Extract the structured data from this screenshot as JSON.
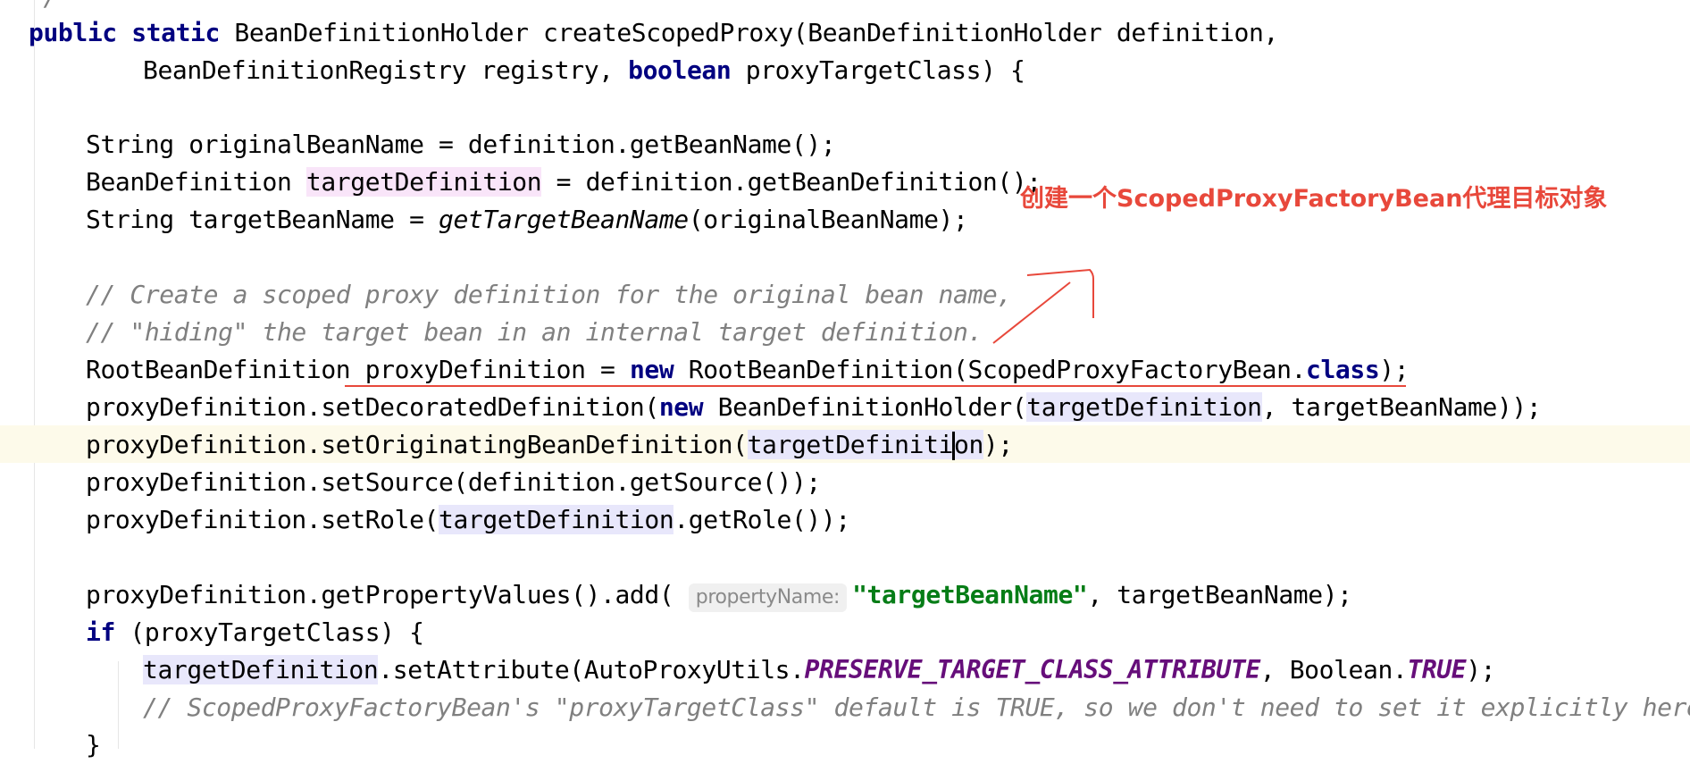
{
  "annotation_text": "创建一个ScopedProxyFactoryBean代理目标对象",
  "annotation_color": "#e8483b",
  "colors": {
    "keyword": "#000080",
    "comment": "#808080",
    "constant": "#660e7a",
    "string": "#067d17",
    "caret_line": "#fdfaea",
    "highlight_write": "#f9e5f9",
    "highlight_read": "#e8e7fb"
  },
  "code": {
    "line0": "*/",
    "line1": {
      "kw1": "public",
      "kw2": "static",
      "rest": " BeanDefinitionHolder createScopedProxy(BeanDefinitionHolder definition,"
    },
    "line2": {
      "pre": "BeanDefinitionRegistry registry, ",
      "kw": "boolean",
      "post": " proxyTargetClass) {"
    },
    "line3": "String originalBeanName = definition.getBeanName();",
    "line4": {
      "pre": "BeanDefinition ",
      "var": "targetDefinition",
      "post": " = definition.getBeanDefinition();"
    },
    "line5": {
      "pre": "String targetBeanName = ",
      "method": "getTargetBeanName",
      "post": "(originalBeanName);"
    },
    "line6": "// Create a scoped proxy definition for the original bean name,",
    "line7": "// \"hiding\" the target bean in an internal target definition.",
    "line8": {
      "pre": "RootBeanDefinition proxyDefinition = ",
      "kw": "new",
      "mid": " RootBeanDefinition(ScopedProxyFactoryBean.",
      "kw2": "class",
      "post": ");"
    },
    "line9": {
      "pre": "proxyDefinition.setDecoratedDefinition(",
      "kw": "new",
      "mid": " BeanDefinitionHolder(",
      "var": "targetDefinition",
      "post": ", targetBeanName));"
    },
    "line10": {
      "pre": "proxyDefinition.setOriginatingBeanDefinition(",
      "var_a": "targetDefiniti",
      "var_b": "on",
      "post": ");"
    },
    "line11": "proxyDefinition.setSource(definition.getSource());",
    "line12": {
      "pre": "proxyDefinition.setRole(",
      "var": "targetDefinition",
      "post": ".getRole());"
    },
    "line13": {
      "pre": "proxyDefinition.getPropertyValues().add( ",
      "hint": "propertyName:",
      "str": "\"targetBeanName\"",
      "post": ", targetBeanName);"
    },
    "line14": {
      "kw": "if",
      "post": " (proxyTargetClass) {"
    },
    "line15": {
      "var": "targetDefinition",
      "mid": ".setAttribute(AutoProxyUtils.",
      "const1": "PRESERVE_TARGET_CLASS_ATTRIBUTE",
      "mid2": ", Boolean.",
      "const2": "TRUE",
      "post": ");"
    },
    "line16": "// ScopedProxyFactoryBean's \"proxyTargetClass\" default is TRUE, so we don't need to set it explicitly here.",
    "line17": "}"
  }
}
